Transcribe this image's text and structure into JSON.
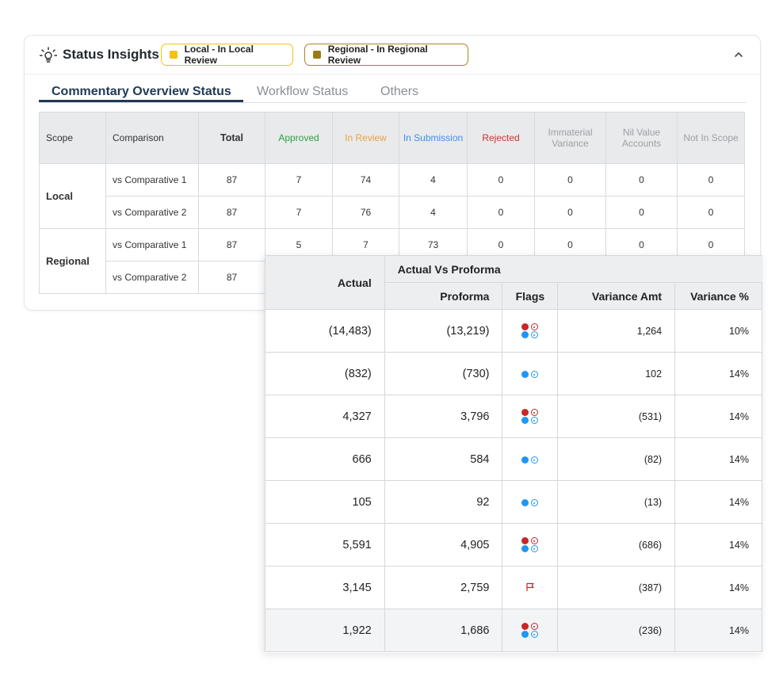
{
  "card": {
    "title": "Status Insights",
    "chips": {
      "local": "Local - In Local Review",
      "regional": "Regional - In Regional Review"
    }
  },
  "tabs": [
    "Commentary Overview Status",
    "Workflow Status",
    "Others"
  ],
  "status_table": {
    "headers": {
      "scope": "Scope",
      "comparison": "Comparison",
      "total": "Total",
      "approved": "Approved",
      "in_review": "In Review",
      "in_submission": "In Submission",
      "rejected": "Rejected",
      "immaterial": "Immaterial Variance",
      "nil": "Nil Value Accounts",
      "not_in_scope": "Not In Scope"
    },
    "groups": [
      {
        "scope": "Local",
        "rows": [
          {
            "comparison": "vs Comparative 1",
            "total": "87",
            "approved": "7",
            "in_review": "74",
            "in_submission": "4",
            "rejected": "0",
            "immaterial": "0",
            "nil": "0",
            "not_in_scope": "0"
          },
          {
            "comparison": "vs Comparative 2",
            "total": "87",
            "approved": "7",
            "in_review": "76",
            "in_submission": "4",
            "rejected": "0",
            "immaterial": "0",
            "nil": "0",
            "not_in_scope": "0"
          }
        ]
      },
      {
        "scope": "Regional",
        "rows": [
          {
            "comparison": "vs Comparative 1",
            "total": "87",
            "approved": "5",
            "in_review": "7",
            "in_submission": "73",
            "rejected": "0",
            "immaterial": "0",
            "nil": "0",
            "not_in_scope": "0"
          },
          {
            "comparison": "vs Comparative 2",
            "total": "87",
            "approved": "",
            "in_review": "",
            "in_submission": "",
            "rejected": "",
            "immaterial": "",
            "nil": "",
            "not_in_scope": ""
          }
        ]
      }
    ]
  },
  "variance_table": {
    "headers": {
      "actual": "Actual",
      "group": "Actual Vs Proforma",
      "proforma": "Proforma",
      "flags": "Flags",
      "variance_amt": "Variance Amt",
      "variance_pct": "Variance %"
    },
    "rows": [
      {
        "actual": "(14,483)",
        "proforma": "(13,219)",
        "flags": "red-blue",
        "variance_amt": "1,264",
        "variance_pct": "10%"
      },
      {
        "actual": "(832)",
        "proforma": "(730)",
        "flags": "blue",
        "variance_amt": "102",
        "variance_pct": "14%"
      },
      {
        "actual": "4,327",
        "proforma": "3,796",
        "flags": "red-blue",
        "variance_amt": "(531)",
        "variance_pct": "14%"
      },
      {
        "actual": "666",
        "proforma": "584",
        "flags": "blue",
        "variance_amt": "(82)",
        "variance_pct": "14%"
      },
      {
        "actual": "105",
        "proforma": "92",
        "flags": "blue",
        "variance_amt": "(13)",
        "variance_pct": "14%"
      },
      {
        "actual": "5,591",
        "proforma": "4,905",
        "flags": "red-blue",
        "variance_amt": "(686)",
        "variance_pct": "14%"
      },
      {
        "actual": "3,145",
        "proforma": "2,759",
        "flags": "flag",
        "variance_amt": "(387)",
        "variance_pct": "14%"
      },
      {
        "actual": "1,922",
        "proforma": "1,686",
        "flags": "red-blue",
        "variance_amt": "(236)",
        "variance_pct": "14%"
      }
    ]
  },
  "icons": {
    "title": "lightbulb-icon",
    "collapse": "chevron-up-icon",
    "flag": "flag-icon"
  },
  "colors": {
    "approved": "#2ea043",
    "in_review": "#e8a33d",
    "in_submission": "#3d8ff2",
    "rejected": "#d0312d",
    "muted": "#9aa0a6",
    "tab_active": "#1f3a55",
    "chip_local": "#f4c20d",
    "chip_regional": "#9a7b17",
    "flag_red": "#c62828",
    "flag_blue": "#2196f3"
  }
}
